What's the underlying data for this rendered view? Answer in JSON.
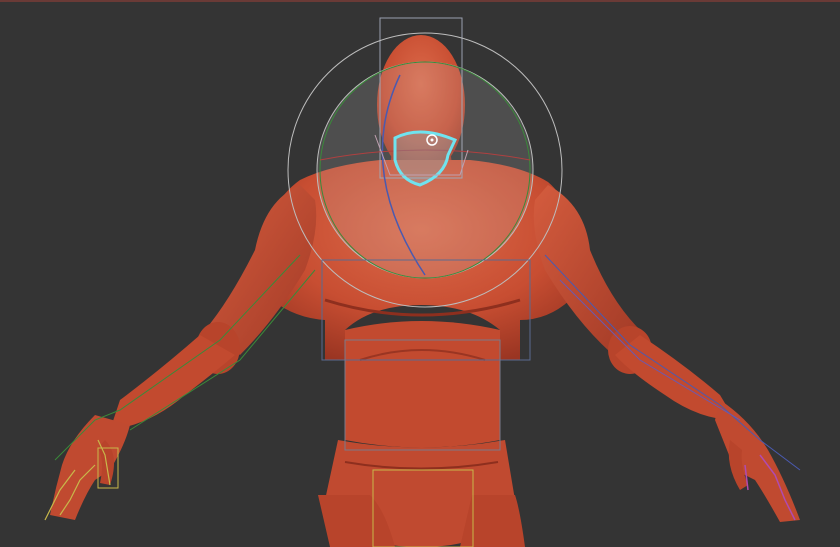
{
  "viewport": {
    "background_color": "#343434",
    "top_strip_color": "#6a3a36"
  },
  "model": {
    "name_icon": "mannequin-figure",
    "skin_color": "#c84e32",
    "skin_shadow_color": "#8e2f1e",
    "skin_highlight_color": "#dc6a4a"
  },
  "rig": {
    "selected_joint_color": "#6fe3ef",
    "sphere_color": "#bdbdbd",
    "green_bone_color": "#3a8a3a",
    "blue_bone_color": "#4a5ab0",
    "yellow_bone_color": "#c8b84a",
    "purple_bone_color": "#b04ab0",
    "gizmo_icon": "rotate-gizmo-icon"
  }
}
